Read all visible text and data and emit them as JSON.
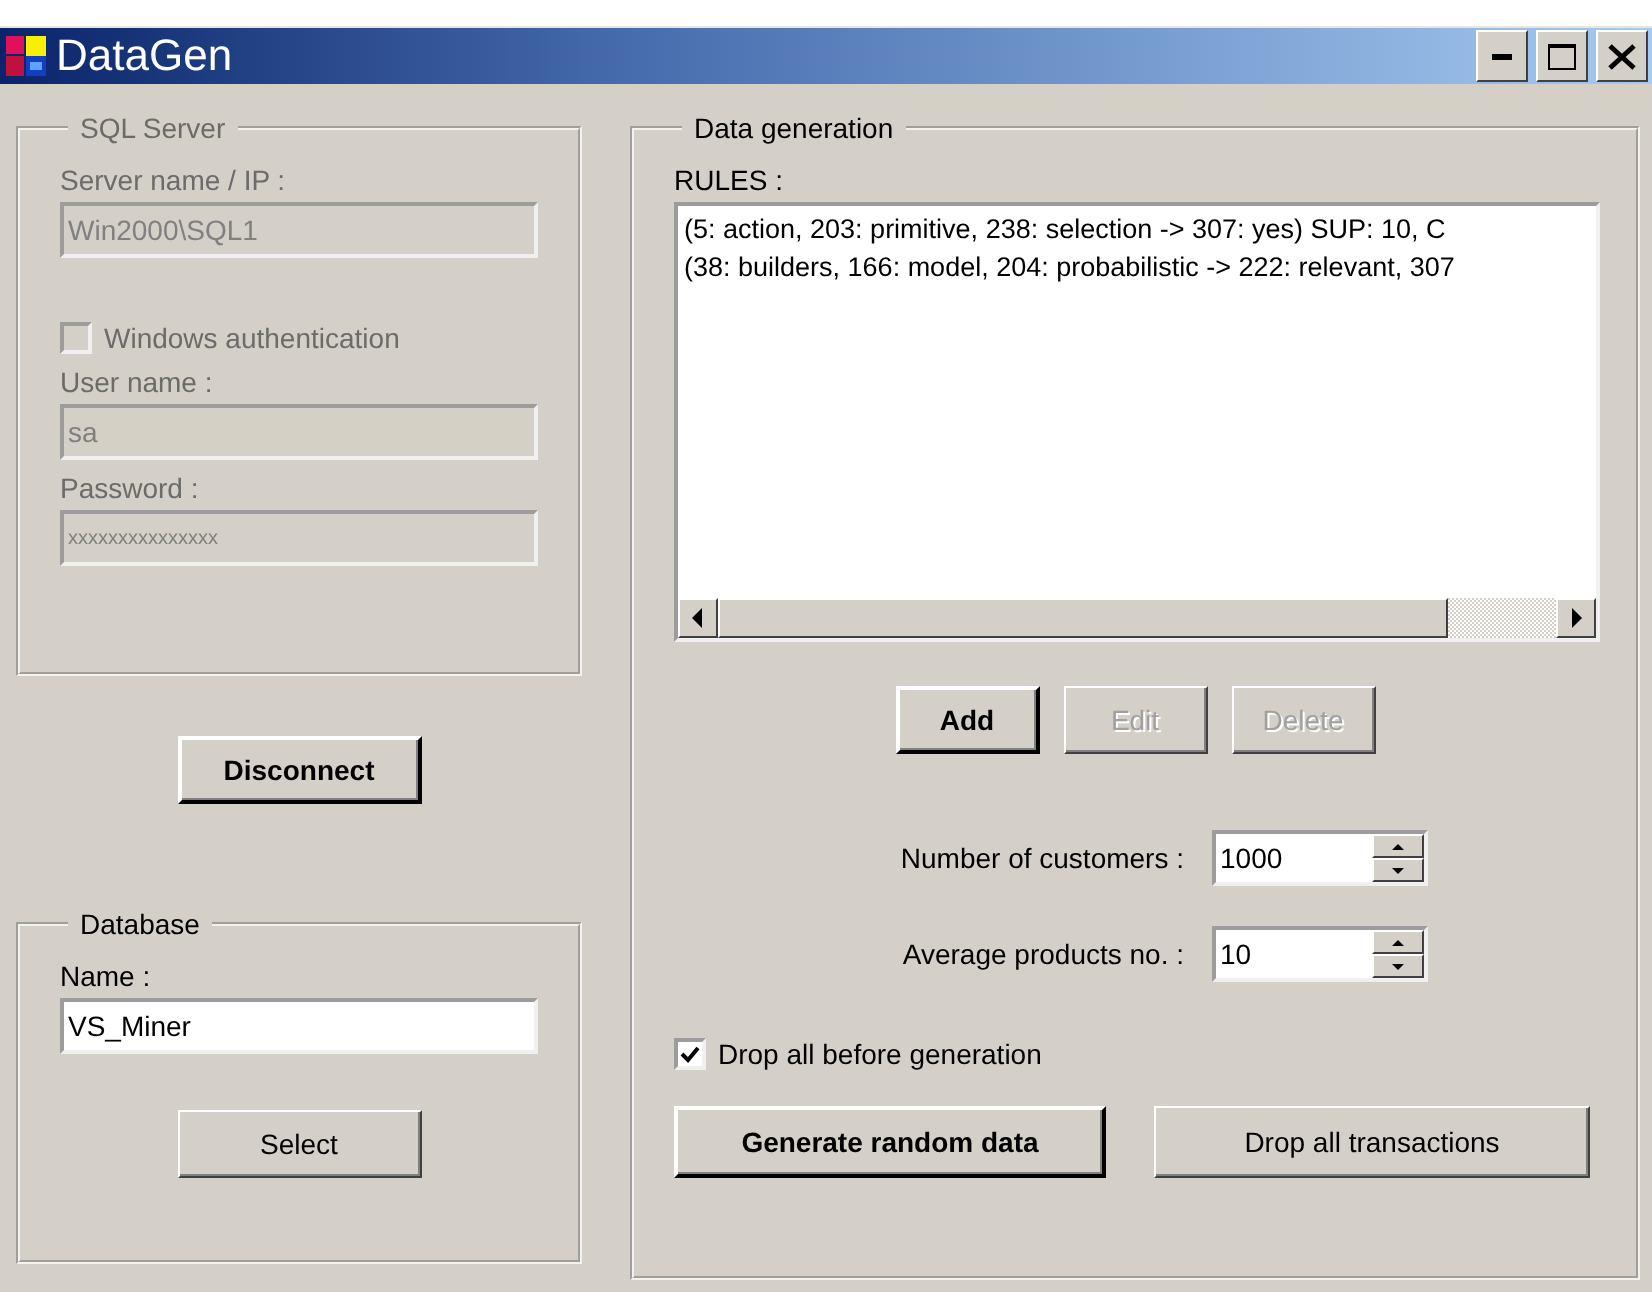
{
  "window": {
    "title": "DataGen",
    "controls": [
      {
        "kind": "minimize"
      },
      {
        "kind": "maximize"
      },
      {
        "kind": "close"
      }
    ]
  },
  "sql_server": {
    "title": "SQL Server",
    "server": {
      "label": "Server name / IP :",
      "value": "Win2000\\SQL1",
      "disabled": true
    },
    "windows_auth": {
      "label": "Windows authentication",
      "checked": false,
      "disabled": true
    },
    "user": {
      "label": "User name :",
      "value": "sa",
      "disabled": true
    },
    "password": {
      "label": "Password :",
      "value": "xxxxxxxxxxxxxxx",
      "disabled": true
    }
  },
  "connect_button": {
    "label": "Disconnect",
    "emphasized": true,
    "disabled": false
  },
  "database": {
    "title": "Database",
    "name": {
      "label": "Name :",
      "value": "VS_Miner",
      "disabled": false
    },
    "select_button": {
      "label": "Select",
      "emphasized": false,
      "disabled": false
    }
  },
  "data_generation": {
    "title": "Data generation",
    "rules_label": "RULES :",
    "rules": [
      "(5: action, 203: primitive, 238: selection -> 307: yes) SUP: 10, C",
      "(38: builders, 166: model, 204: probabilistic -> 222: relevant, 307"
    ],
    "rule_buttons": [
      {
        "label": "Add",
        "emphasized": true,
        "disabled": false
      },
      {
        "label": "Edit",
        "emphasized": false,
        "disabled": true
      },
      {
        "label": "Delete",
        "emphasized": false,
        "disabled": true
      }
    ],
    "spinners": [
      {
        "label": "Number of customers :",
        "value": "1000"
      },
      {
        "label": "Average products no. :",
        "value": "10"
      }
    ],
    "drop_all_checkbox": {
      "label": "Drop all before generation",
      "checked": true,
      "disabled": false
    },
    "action_buttons": [
      {
        "label": "Generate random data",
        "emphasized": true,
        "disabled": false
      },
      {
        "label": "Drop all transactions",
        "emphasized": false,
        "disabled": false
      }
    ]
  }
}
